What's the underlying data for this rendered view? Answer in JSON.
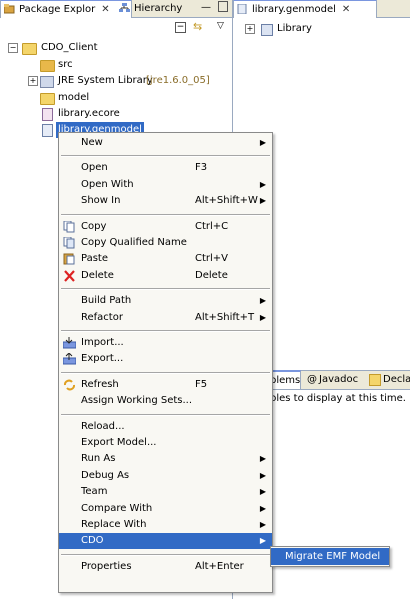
{
  "left_view": {
    "tabs": [
      {
        "label": "Package Explor",
        "active": true,
        "icon": "package-explorer-icon"
      },
      {
        "label": "Hierarchy",
        "active": false,
        "icon": "hierarchy-icon"
      }
    ],
    "tree": [
      {
        "label": "CDO_Client",
        "icon": "project-icon",
        "expanded": true
      },
      {
        "label": "src",
        "icon": "source-folder-icon"
      },
      {
        "label": "JRE System Library",
        "decoration": "[jre1.6.0_05]",
        "icon": "library-icon"
      },
      {
        "label": "model",
        "icon": "folder-icon"
      },
      {
        "label": "library.ecore",
        "icon": "ecore-file-icon"
      },
      {
        "label": "library.genmodel",
        "icon": "genmodel-file-icon",
        "selected": true
      }
    ]
  },
  "right_view": {
    "tab_label": "library.genmodel",
    "tree_item": "Library",
    "bottom_tabs": [
      "blems",
      "Javadoc",
      "Decla"
    ],
    "bottom_message": "soles to display at this time."
  },
  "context_menu": {
    "items": [
      {
        "label": "New",
        "shortcut": "",
        "submenu": true
      },
      {
        "separator": true
      },
      {
        "label": "Open",
        "shortcut": "F3"
      },
      {
        "label": "Open With",
        "shortcut": "",
        "submenu": true
      },
      {
        "label": "Show In",
        "shortcut": "Alt+Shift+W",
        "submenu": true
      },
      {
        "separator": true
      },
      {
        "label": "Copy",
        "shortcut": "Ctrl+C",
        "icon": "copy-icon"
      },
      {
        "label": "Copy Qualified Name",
        "shortcut": "",
        "icon": "copy-qualified-name-icon"
      },
      {
        "label": "Paste",
        "shortcut": "Ctrl+V",
        "icon": "paste-icon"
      },
      {
        "label": "Delete",
        "shortcut": "Delete",
        "icon": "delete-icon"
      },
      {
        "separator": true
      },
      {
        "label": "Build Path",
        "shortcut": "",
        "submenu": true
      },
      {
        "label": "Refactor",
        "shortcut": "Alt+Shift+T",
        "submenu": true
      },
      {
        "separator": true
      },
      {
        "label": "Import...",
        "shortcut": "",
        "icon": "import-icon"
      },
      {
        "label": "Export...",
        "shortcut": "",
        "icon": "export-icon"
      },
      {
        "separator": true
      },
      {
        "label": "Refresh",
        "shortcut": "F5",
        "icon": "refresh-icon"
      },
      {
        "label": "Assign Working Sets...",
        "shortcut": ""
      },
      {
        "separator": true
      },
      {
        "label": "Reload...",
        "shortcut": ""
      },
      {
        "label": "Export Model...",
        "shortcut": ""
      },
      {
        "label": "Run As",
        "shortcut": "",
        "submenu": true
      },
      {
        "label": "Debug As",
        "shortcut": "",
        "submenu": true
      },
      {
        "label": "Team",
        "shortcut": "",
        "submenu": true
      },
      {
        "label": "Compare With",
        "shortcut": "",
        "submenu": true
      },
      {
        "label": "Replace With",
        "shortcut": "",
        "submenu": true
      },
      {
        "label": "CDO",
        "shortcut": "",
        "submenu": true,
        "highlighted": true
      },
      {
        "separator": true
      },
      {
        "label": "Properties",
        "shortcut": "Alt+Enter"
      }
    ],
    "submenu": {
      "label": "Migrate EMF Model"
    }
  },
  "colors": {
    "selection": "#316ac5",
    "menu_bg": "#f9f8f3",
    "tab_bg": "#ece9d8"
  }
}
